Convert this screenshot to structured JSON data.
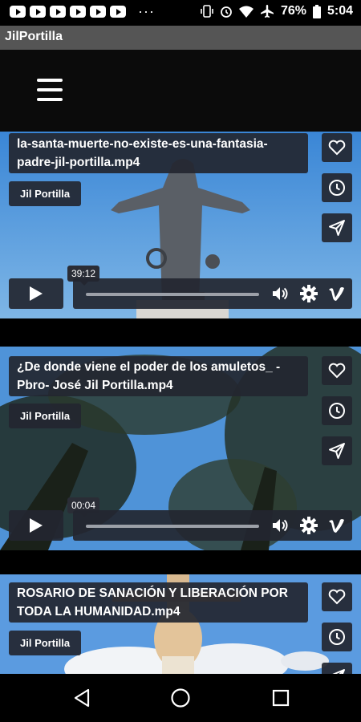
{
  "status_bar": {
    "battery": "76%",
    "time": "5:04",
    "notification_icons": [
      "youtube-icon",
      "youtube-icon",
      "youtube-icon",
      "youtube-icon",
      "youtube-icon",
      "youtube-icon"
    ],
    "overflow": "···"
  },
  "app": {
    "title": "JilPortilla"
  },
  "videos": [
    {
      "title": "la-santa-muerte-no-existe-es-una-fantasia-padre-jil-portilla.mp4",
      "author": "Jil Portilla",
      "duration": "39:12"
    },
    {
      "title": "¿De donde viene el poder de los amuletos_ - Pbro- José Jil Portilla.mp4",
      "author": "Jil Portilla",
      "duration": "00:04"
    },
    {
      "title": "ROSARIO DE SANACIÓN Y LIBERACIÓN POR TODA LA HUMANIDAD.mp4",
      "author": "Jil Portilla",
      "duration": ""
    }
  ],
  "colors": {
    "overlay": "#232630",
    "app_title_bar": "#555555",
    "sky_blue": "#4f93d8"
  }
}
